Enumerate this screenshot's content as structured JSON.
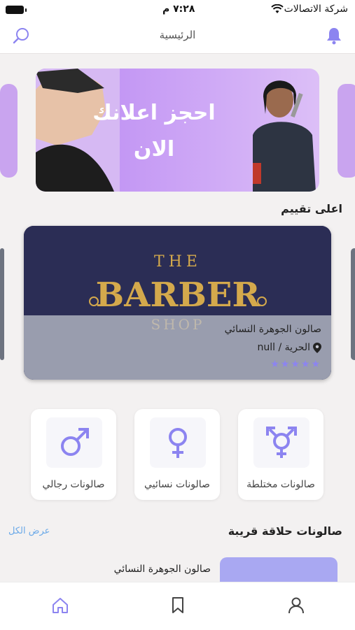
{
  "status_bar": {
    "carrier": "شركة الاتصالات",
    "time": "٧:٢٨ م"
  },
  "header": {
    "title": "الرئيسية"
  },
  "ad_banner": {
    "line1": "احجز اعلانك",
    "line2": "الان"
  },
  "top_rated": {
    "title": "اعلى تقييم",
    "salon": {
      "name": "صالون الجوهرة النسائي",
      "location": "الحرية / null",
      "rating": 0,
      "max_rating": 5
    }
  },
  "categories": [
    {
      "label": "صالونات مختلطة",
      "icon": "transgender-icon"
    },
    {
      "label": "صالونات نسائيي",
      "icon": "female-icon"
    },
    {
      "label": "صالونات رجالي",
      "icon": "male-icon"
    }
  ],
  "nearby": {
    "title": "صالونات حلاقة قريبة",
    "see_all": "عرض الكل",
    "first_salon_name": "صالون الجوهرة النسائي"
  },
  "bottom_nav": [
    "home-icon",
    "bookmark-icon",
    "profile-icon"
  ],
  "colors": {
    "accent": "#8c84f0",
    "banner": "#c29cf3",
    "link": "#6aa9e8"
  }
}
